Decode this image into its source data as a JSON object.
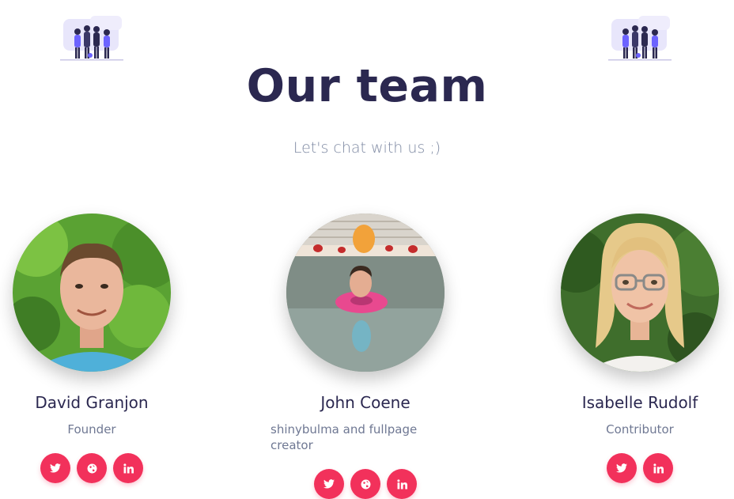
{
  "header": {
    "title": "Our team",
    "subtitle": "Let's chat with us ;)"
  },
  "members": [
    {
      "name": "David Granjon",
      "role": "Founder",
      "socials": [
        "twitter-icon",
        "globe-icon",
        "linkedin-icon"
      ]
    },
    {
      "name": "John Coene",
      "role": "shinybulma and fullpage creator",
      "socials": [
        "twitter-icon",
        "globe-icon",
        "linkedin-icon"
      ]
    },
    {
      "name": "Isabelle Rudolf",
      "role": "Contributor",
      "socials": [
        "twitter-icon",
        "linkedin-icon"
      ]
    }
  ],
  "colors": {
    "accent": "#f2315b",
    "title": "#2b2850",
    "muted": "#7f8aa3"
  }
}
